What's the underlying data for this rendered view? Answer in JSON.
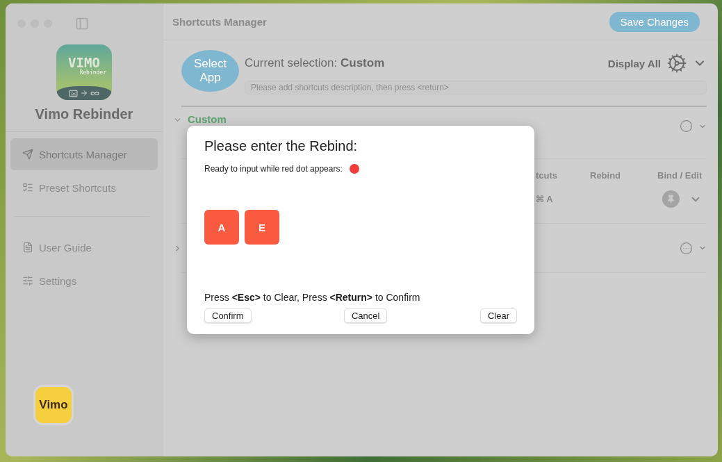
{
  "window": {
    "title": "Shortcuts Manager"
  },
  "toolbar": {
    "save_button": "Save Changes"
  },
  "sidebar": {
    "logo_text": "VIMO",
    "logo_subtext": "Rebinder",
    "app_name": "Vimo Rebinder",
    "items": [
      {
        "label": "Shortcuts Manager",
        "selected": true
      },
      {
        "label": "Preset Shortcuts",
        "selected": false
      }
    ],
    "secondary_items": [
      {
        "label": "User Guide"
      },
      {
        "label": "Settings"
      }
    ],
    "badge": "Vimo"
  },
  "header": {
    "select_app_button": "Select App",
    "selection_label": "Current selection:",
    "selection_value": "Custom",
    "display_mode": "Display All",
    "description_placeholder": "Please add shortcuts description, then press <return>"
  },
  "sections": [
    {
      "title": "Custom",
      "expanded": true,
      "columns": [
        "tcuts",
        "Rebind",
        "Bind / Edit"
      ],
      "rows": [
        {
          "shortcut": "⌘ A"
        }
      ]
    },
    {
      "expanded": false
    }
  ],
  "dialog": {
    "title": "Please enter the Rebind:",
    "status_text": "Ready to input while red dot appears:",
    "recording": true,
    "keys": [
      "A",
      "E"
    ],
    "hint": "Press **<Esc>** to Clear, Press **<Return>** to Confirm",
    "buttons": [
      "Confirm",
      "Cancel",
      "Clear"
    ]
  }
}
